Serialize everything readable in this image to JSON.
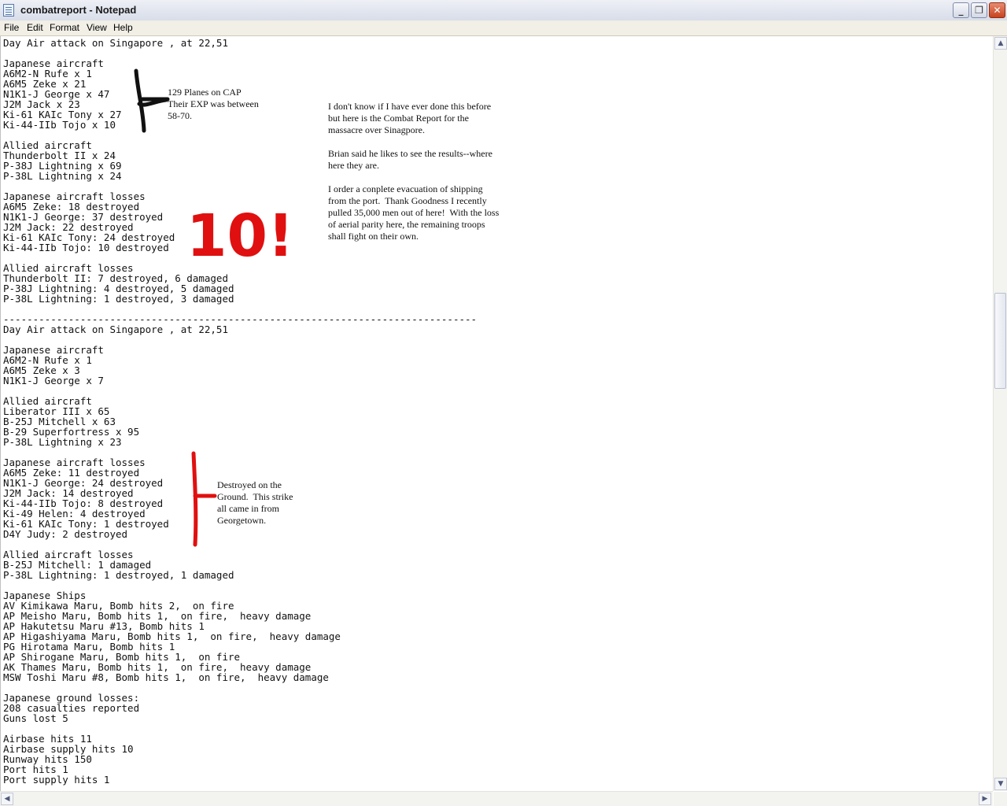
{
  "window": {
    "title": "combatreport - Notepad"
  },
  "menu": {
    "file": "File",
    "edit": "Edit",
    "format": "Format",
    "view": "View",
    "help": "Help"
  },
  "editor_lines": [
    "Day Air attack on Singapore , at 22,51",
    "",
    "Japanese aircraft",
    "A6M2-N Rufe x 1",
    "A6M5 Zeke x 21",
    "N1K1-J George x 47",
    "J2M Jack x 23",
    "Ki-61 KAIc Tony x 27",
    "Ki-44-IIb Tojo x 10",
    "",
    "Allied aircraft",
    "Thunderbolt II x 24",
    "P-38J Lightning x 69",
    "P-38L Lightning x 24",
    "",
    "Japanese aircraft losses",
    "A6M5 Zeke: 18 destroyed",
    "N1K1-J George: 37 destroyed",
    "J2M Jack: 22 destroyed",
    "Ki-61 KAIc Tony: 24 destroyed",
    "Ki-44-IIb Tojo: 10 destroyed",
    "",
    "Allied aircraft losses",
    "Thunderbolt II: 7 destroyed, 6 damaged",
    "P-38J Lightning: 4 destroyed, 5 damaged",
    "P-38L Lightning: 1 destroyed, 3 damaged",
    "",
    "--------------------------------------------------------------------------------",
    "Day Air attack on Singapore , at 22,51",
    "",
    "Japanese aircraft",
    "A6M2-N Rufe x 1",
    "A6M5 Zeke x 3",
    "N1K1-J George x 7",
    "",
    "Allied aircraft",
    "Liberator III x 65",
    "B-25J Mitchell x 63",
    "B-29 Superfortress x 95",
    "P-38L Lightning x 23",
    "",
    "Japanese aircraft losses",
    "A6M5 Zeke: 11 destroyed",
    "N1K1-J George: 24 destroyed",
    "J2M Jack: 14 destroyed",
    "Ki-44-IIb Tojo: 8 destroyed",
    "Ki-49 Helen: 4 destroyed",
    "Ki-61 KAIc Tony: 1 destroyed",
    "D4Y Judy: 2 destroyed",
    "",
    "Allied aircraft losses",
    "B-25J Mitchell: 1 damaged",
    "P-38L Lightning: 1 destroyed, 1 damaged",
    "",
    "Japanese Ships",
    "AV Kimikawa Maru, Bomb hits 2,  on fire",
    "AP Meisho Maru, Bomb hits 1,  on fire,  heavy damage",
    "AP Hakutetsu Maru #13, Bomb hits 1",
    "AP Higashiyama Maru, Bomb hits 1,  on fire,  heavy damage",
    "PG Hirotama Maru, Bomb hits 1",
    "AP Shirogane Maru, Bomb hits 1,  on fire",
    "AK Thames Maru, Bomb hits 1,  on fire,  heavy damage",
    "MSW Toshi Maru #8, Bomb hits 1,  on fire,  heavy damage",
    "",
    "Japanese ground losses:",
    "208 casualties reported",
    "Guns lost 5",
    "",
    "Airbase hits 11",
    "Airbase supply hits 10",
    "Runway hits 150",
    "Port hits 1",
    "Port supply hits 1"
  ],
  "annotations": {
    "cap_note": "129 Planes on CAP\nTheir EXP was between\n58-70.",
    "big_note": "I don't know if I have ever done this before\nbut here is the Combat Report for the\nmassacre over Sinagpore.\n\nBrian said he likes to see the results--where\nhere they are.\n\nI order a conplete evacuation of shipping\nfrom the port.  Thank Goodness I recently\npulled 35,000 men out of here!  With the loss\nof aerial parity here, the remaining troops\nshall fight on their own.",
    "ground_note": "Destroyed on the\nGround.  This strike\nall came in from\nGeorgetown.",
    "count_mark": "10!"
  },
  "colors": {
    "black_ink": "#111111",
    "red_ink": "#e01010"
  },
  "icons": {
    "minimize": "minimize-icon",
    "maximize": "restore-icon",
    "close": "close-icon"
  }
}
